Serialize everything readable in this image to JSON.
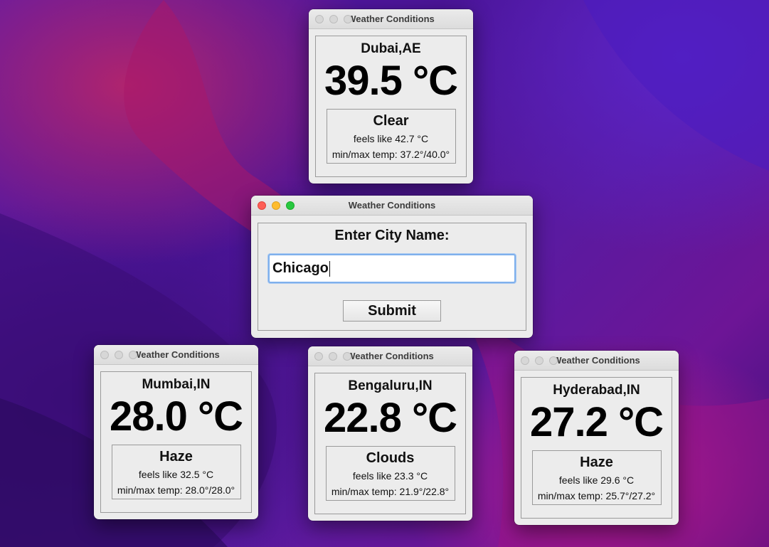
{
  "window_title": "Weather Conditions",
  "colors": {
    "close": "#fe5f57",
    "minimize": "#febc2e",
    "zoom": "#28c840",
    "input_focus": "#7fb0ec"
  },
  "input_window": {
    "prompt": "Enter City Name:",
    "city_value": "Chicago",
    "submit_label": "Submit"
  },
  "windows": [
    {
      "city": "Dubai,AE",
      "temp": "39.5 °C",
      "condition": "Clear",
      "feels_like": "feels like 42.7 °C",
      "min_max": "min/max temp: 37.2°/40.0°"
    },
    {
      "city": "Mumbai,IN",
      "temp": "28.0 °C",
      "condition": "Haze",
      "feels_like": "feels like 32.5 °C",
      "min_max": "min/max temp: 28.0°/28.0°"
    },
    {
      "city": "Bengaluru,IN",
      "temp": "22.8 °C",
      "condition": "Clouds",
      "feels_like": "feels like 23.3 °C",
      "min_max": "min/max temp: 21.9°/22.8°"
    },
    {
      "city": "Hyderabad,IN",
      "temp": "27.2 °C",
      "condition": "Haze",
      "feels_like": "feels like 29.6 °C",
      "min_max": "min/max temp: 25.7°/27.2°"
    }
  ]
}
